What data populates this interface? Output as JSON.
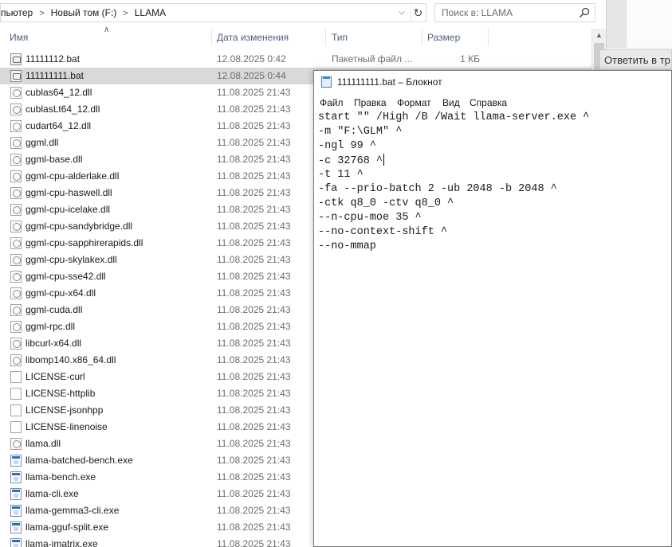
{
  "explorer": {
    "breadcrumb": [
      "пьютер",
      "Новый том (F:)",
      "LLAMA"
    ],
    "search_placeholder": "Поиск в: LLAMA",
    "columns": {
      "name": "Имя",
      "date": "Дата изменения",
      "type": "Тип",
      "size": "Размер"
    },
    "files": [
      {
        "name": "11111112.bat",
        "date": "12.08.2025 0:42",
        "type": "Пакетный файл ...",
        "size": "1 КБ",
        "icon": "bat"
      },
      {
        "name": "111111111.bat",
        "date": "12.08.2025 0:44",
        "type": "",
        "size": "",
        "icon": "bat",
        "selected": true
      },
      {
        "name": "cublas64_12.dll",
        "date": "11.08.2025 21:43",
        "type": "",
        "size": "",
        "icon": "dll"
      },
      {
        "name": "cublasLt64_12.dll",
        "date": "11.08.2025 21:43",
        "type": "",
        "size": "",
        "icon": "dll"
      },
      {
        "name": "cudart64_12.dll",
        "date": "11.08.2025 21:43",
        "type": "",
        "size": "",
        "icon": "dll"
      },
      {
        "name": "ggml.dll",
        "date": "11.08.2025 21:43",
        "type": "",
        "size": "",
        "icon": "dll"
      },
      {
        "name": "ggml-base.dll",
        "date": "11.08.2025 21:43",
        "type": "",
        "size": "",
        "icon": "dll"
      },
      {
        "name": "ggml-cpu-alderlake.dll",
        "date": "11.08.2025 21:43",
        "type": "",
        "size": "",
        "icon": "dll"
      },
      {
        "name": "ggml-cpu-haswell.dll",
        "date": "11.08.2025 21:43",
        "type": "",
        "size": "",
        "icon": "dll"
      },
      {
        "name": "ggml-cpu-icelake.dll",
        "date": "11.08.2025 21:43",
        "type": "",
        "size": "",
        "icon": "dll"
      },
      {
        "name": "ggml-cpu-sandybridge.dll",
        "date": "11.08.2025 21:43",
        "type": "",
        "size": "",
        "icon": "dll"
      },
      {
        "name": "ggml-cpu-sapphirerapids.dll",
        "date": "11.08.2025 21:43",
        "type": "",
        "size": "",
        "icon": "dll"
      },
      {
        "name": "ggml-cpu-skylakex.dll",
        "date": "11.08.2025 21:43",
        "type": "",
        "size": "",
        "icon": "dll"
      },
      {
        "name": "ggml-cpu-sse42.dll",
        "date": "11.08.2025 21:43",
        "type": "",
        "size": "",
        "icon": "dll"
      },
      {
        "name": "ggml-cpu-x64.dll",
        "date": "11.08.2025 21:43",
        "type": "",
        "size": "",
        "icon": "dll"
      },
      {
        "name": "ggml-cuda.dll",
        "date": "11.08.2025 21:43",
        "type": "",
        "size": "",
        "icon": "dll"
      },
      {
        "name": "ggml-rpc.dll",
        "date": "11.08.2025 21:43",
        "type": "",
        "size": "",
        "icon": "dll"
      },
      {
        "name": "libcurl-x64.dll",
        "date": "11.08.2025 21:43",
        "type": "",
        "size": "",
        "icon": "dll"
      },
      {
        "name": "libomp140.x86_64.dll",
        "date": "11.08.2025 21:43",
        "type": "",
        "size": "",
        "icon": "dll"
      },
      {
        "name": "LICENSE-curl",
        "date": "11.08.2025 21:43",
        "type": "",
        "size": "",
        "icon": "doc"
      },
      {
        "name": "LICENSE-httplib",
        "date": "11.08.2025 21:43",
        "type": "",
        "size": "",
        "icon": "doc"
      },
      {
        "name": "LICENSE-jsonhpp",
        "date": "11.08.2025 21:43",
        "type": "",
        "size": "",
        "icon": "doc"
      },
      {
        "name": "LICENSE-linenoise",
        "date": "11.08.2025 21:43",
        "type": "",
        "size": "",
        "icon": "doc"
      },
      {
        "name": "llama.dll",
        "date": "11.08.2025 21:43",
        "type": "",
        "size": "",
        "icon": "dll"
      },
      {
        "name": "llama-batched-bench.exe",
        "date": "11.08.2025 21:43",
        "type": "",
        "size": "",
        "icon": "exe"
      },
      {
        "name": "llama-bench.exe",
        "date": "11.08.2025 21:43",
        "type": "",
        "size": "",
        "icon": "exe"
      },
      {
        "name": "llama-cli.exe",
        "date": "11.08.2025 21:43",
        "type": "",
        "size": "",
        "icon": "exe"
      },
      {
        "name": "llama-gemma3-cli.exe",
        "date": "11.08.2025 21:43",
        "type": "",
        "size": "",
        "icon": "exe"
      },
      {
        "name": "llama-gguf-split.exe",
        "date": "11.08.2025 21:43",
        "type": "",
        "size": "",
        "icon": "exe"
      },
      {
        "name": "llama-imatrix.exe",
        "date": "11.08.2025 21:43",
        "type": "",
        "size": "",
        "icon": "exe"
      }
    ]
  },
  "background_app": {
    "reply_label": "Ответить в тр"
  },
  "notepad": {
    "title": "111111111.bat – Блокнот",
    "menu": [
      "Файл",
      "Правка",
      "Формат",
      "Вид",
      "Справка"
    ],
    "lines": [
      "start \"\" /High /B /Wait llama-server.exe ^",
      "-m \"F:\\GLM\" ^",
      "-ngl 99 ^",
      "-c 32768 ^",
      "-t 11 ^",
      "-fa --prio-batch 2 -ub 2048 -b 2048 ^",
      "-ctk q8_0 -ctv q8_0 ^",
      "--n-cpu-moe 35 ^",
      "--no-context-shift ^",
      "--no-mmap"
    ],
    "caret_line": 3
  }
}
